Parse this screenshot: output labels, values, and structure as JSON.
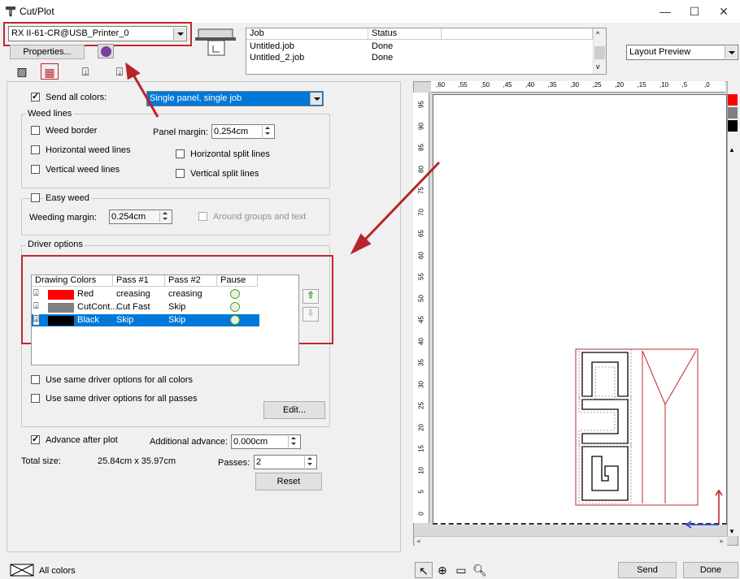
{
  "window": {
    "title": "Cut/Plot",
    "minimize": "—",
    "maximize": "☐",
    "close": "✕"
  },
  "printer": {
    "selected": "RX II-61-CR@USB_Printer_0",
    "properties_label": "Properties..."
  },
  "jobs": {
    "columns": [
      "Job",
      "Status"
    ],
    "rows": [
      {
        "job": "Untitled.job",
        "status": "Done"
      },
      {
        "job": "Untitled_2.job",
        "status": "Done"
      }
    ]
  },
  "preview_mode": {
    "selected": "Layout Preview"
  },
  "options": {
    "send_all_colors_label": "Send all colors:",
    "send_all_colors_checked": true,
    "panel_mode": "Single panel, single job",
    "weed_lines_group": "Weed lines",
    "weed_border": "Weed border",
    "panel_margin_label": "Panel margin:",
    "panel_margin": "0.254cm",
    "horizontal_weed_lines": "Horizontal weed lines",
    "horizontal_split_lines": "Horizontal split lines",
    "vertical_weed_lines": "Vertical weed lines",
    "vertical_split_lines": "Vertical split lines",
    "easy_weed": "Easy weed",
    "weeding_margin_label": "Weeding margin:",
    "weeding_margin": "0.254cm",
    "around_groups": "Around groups and text",
    "driver_options_group": "Driver options",
    "same_driver_colors": "Use same driver options for all colors",
    "same_driver_passes": "Use same driver options for all passes",
    "edit_label": "Edit...",
    "advance_after_plot": "Advance after plot",
    "advance_checked": true,
    "additional_advance_label": "Additional advance:",
    "additional_advance": "0.000cm",
    "total_size_label": "Total size:",
    "total_size": "25.84cm x 35.97cm",
    "passes_label": "Passes:",
    "passes": "2",
    "reset_label": "Reset"
  },
  "driver_table": {
    "columns": [
      "Drawing Colors",
      "Pass #1",
      "Pass #2",
      "Pause"
    ],
    "rows": [
      {
        "name": "Red",
        "pass1": "creasing",
        "pass2": "creasing",
        "color": "#ff0000",
        "selected": false
      },
      {
        "name": "CutCont...",
        "pass1": "Cut Fast",
        "pass2": "Skip",
        "color": "#808080",
        "selected": false
      },
      {
        "name": "Black",
        "pass1": "Skip",
        "pass2": "Skip",
        "color": "#000000",
        "selected": true
      }
    ]
  },
  "ruler": {
    "top": [
      ",60",
      ",55",
      ",50",
      ",45",
      ",40",
      ",35",
      ",30",
      ",25",
      ",20",
      ",15",
      ",10",
      ",5",
      ",0"
    ],
    "left": [
      "95",
      "90",
      "85",
      "80",
      "75",
      "70",
      "65",
      "60",
      "55",
      "50",
      "45",
      "40",
      "35",
      "30",
      "25",
      "20",
      "15",
      "10",
      "5",
      "0"
    ]
  },
  "palette": [
    "#ff0000",
    "#808080",
    "#000000"
  ],
  "footer": {
    "all_colors": "All colors",
    "send_label": "Send",
    "done_label": "Done"
  },
  "colors": {
    "accent_red": "#c0272d",
    "selection_blue": "#0078d7"
  }
}
